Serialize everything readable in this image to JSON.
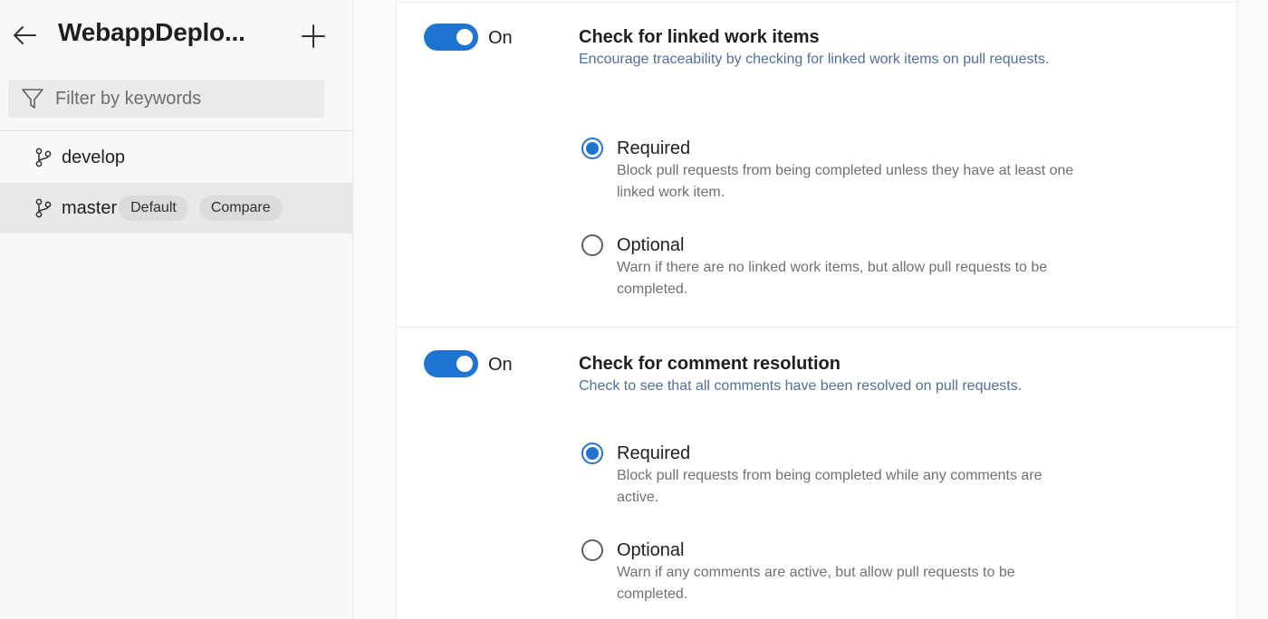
{
  "sidebar": {
    "repo_title": "WebappDeplo...",
    "filter_placeholder": "Filter by keywords",
    "branches": [
      {
        "name": "develop",
        "selected": false
      },
      {
        "name": "master",
        "selected": true,
        "badges": [
          "Default",
          "Compare"
        ]
      }
    ]
  },
  "policies": [
    {
      "toggle_label": "On",
      "toggle_on": true,
      "title": "Check for linked work items",
      "description": "Encourage traceability by checking for linked work items on pull requests.",
      "options": [
        {
          "label": "Required",
          "checked": true,
          "description": "Block pull requests from being completed unless they have at least one linked work item."
        },
        {
          "label": "Optional",
          "checked": false,
          "description": "Warn if there are no linked work items, but allow pull requests to be completed."
        }
      ]
    },
    {
      "toggle_label": "On",
      "toggle_on": true,
      "title": "Check for comment resolution",
      "description": "Check to see that all comments have been resolved on pull requests.",
      "options": [
        {
          "label": "Required",
          "checked": true,
          "description": "Block pull requests from being completed while any comments are active."
        },
        {
          "label": "Optional",
          "checked": false,
          "description": "Warn if any comments are active, but allow pull requests to be completed."
        }
      ]
    }
  ],
  "colors": {
    "accent": "#1f73d1",
    "sidebar_bg": "#f8f8f8",
    "selected_row": "#e8e8e8"
  }
}
